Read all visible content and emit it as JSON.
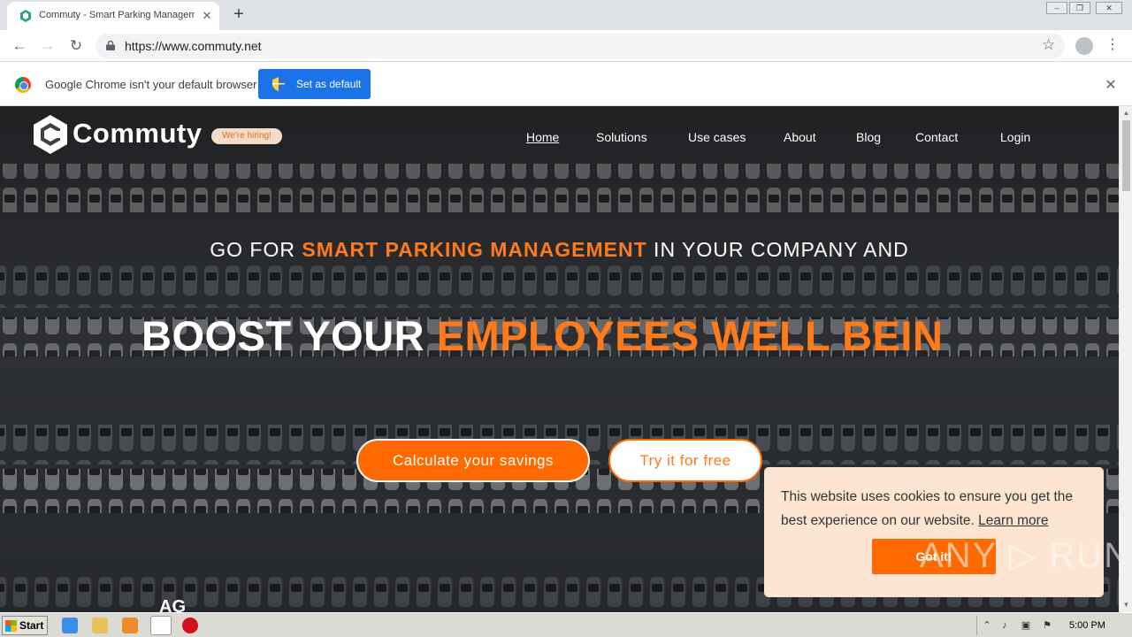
{
  "browser": {
    "tab_title": "Commuty - Smart Parking Management",
    "tab_close": "✕",
    "new_tab": "+",
    "url": "https://www.commuty.net",
    "window_controls": [
      "minimize",
      "restore",
      "close"
    ]
  },
  "infobar": {
    "message": "Google Chrome isn't your default browser",
    "button": "Set as default",
    "close": "✕"
  },
  "site": {
    "brand": "Commuty",
    "hiring_badge": "We're hiring!",
    "nav": [
      "Home",
      "Solutions",
      "Use cases",
      "About",
      "Blog",
      "Contact",
      "Login"
    ],
    "active_nav": "Home",
    "headline1_a": "GO FOR ",
    "headline1_b": "SMART PARKING MANAGEMENT",
    "headline1_c": " IN YOUR COMPANY AND",
    "headline2_a": "BOOST YOUR ",
    "headline2_b": "EMPLOYEES WELL BEIN",
    "cta_primary": "Calculate your savings",
    "cta_secondary": "Try it for free",
    "clients_partial": "AG"
  },
  "cookie": {
    "text": "This website uses cookies to ensure you get the best experience on our website. ",
    "link": "Learn more",
    "button": "Got it!"
  },
  "watermark": "ANY ▷ RUN",
  "taskbar": {
    "start": "Start",
    "clock": "5:00 PM"
  },
  "colors": {
    "accent": "#ff6a00",
    "chrome_blue": "#1a73e8",
    "cookie_bg": "#fde5d2"
  }
}
